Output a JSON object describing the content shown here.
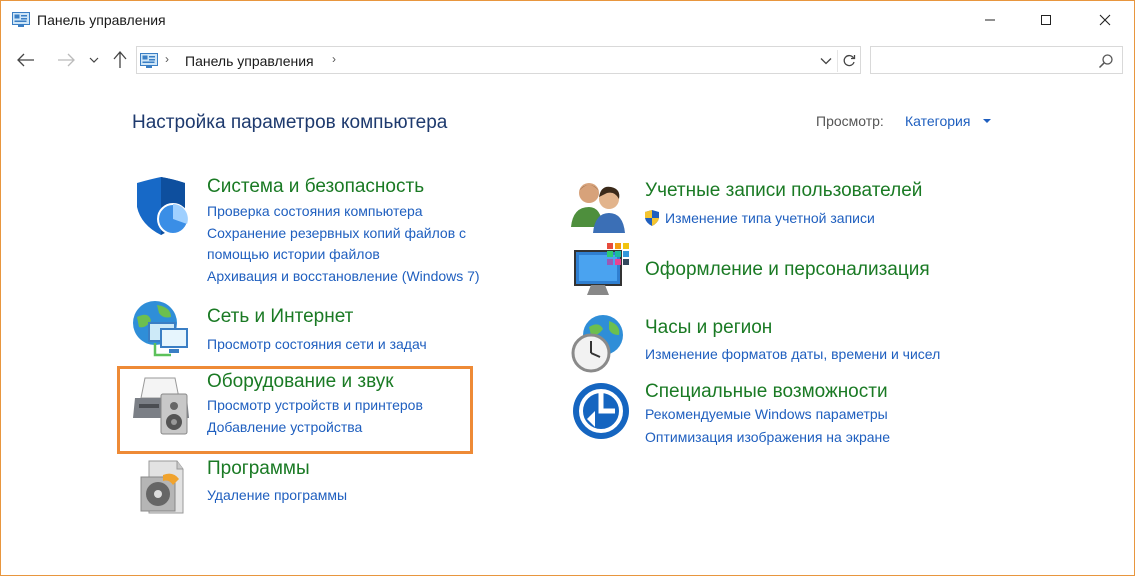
{
  "window": {
    "title": "Панель управления",
    "icons": {
      "app": "control-panel-icon",
      "minimize": "minimize-icon",
      "maximize": "maximize-icon",
      "close": "close-icon"
    }
  },
  "nav": {
    "address_path": "Панель управления",
    "search_placeholder": "",
    "icons": {
      "back": "arrow-left-icon",
      "forward": "arrow-right-icon",
      "recent": "chevron-down-icon",
      "up": "arrow-up-icon",
      "refresh": "refresh-icon",
      "search": "search-icon"
    }
  },
  "content": {
    "title": "Настройка параметров компьютера",
    "view_label": "Просмотр:",
    "view_value": "Категория"
  },
  "categories": {
    "security": {
      "title": "Система и безопасность",
      "links": [
        "Проверка состояния компьютера",
        "Сохранение резервных копий файлов с",
        "помощью истории файлов",
        "Архивация и восстановление (Windows 7)"
      ]
    },
    "network": {
      "title": "Сеть и Интернет",
      "links": [
        "Просмотр состояния сети и задач"
      ]
    },
    "hardware": {
      "title": "Оборудование и звук",
      "links": [
        "Просмотр устройств и принтеров",
        "Добавление устройства"
      ]
    },
    "programs": {
      "title": "Программы",
      "links": [
        "Удаление программы"
      ]
    },
    "accounts": {
      "title": "Учетные записи пользователей",
      "links": [
        "Изменение типа учетной записи"
      ]
    },
    "appearance": {
      "title": "Оформление и персонализация",
      "links": []
    },
    "clock": {
      "title": "Часы и регион",
      "links": [
        "Изменение форматов даты, времени и чисел"
      ]
    },
    "access": {
      "title": "Специальные возможности",
      "links": [
        "Рекомендуемые Windows параметры",
        "Оптимизация изображения на экране"
      ]
    }
  },
  "colors": {
    "accent_border": "#ee8a36",
    "category_title": "#1a7a24",
    "link": "#1f5fbf",
    "page_title": "#1e3a6e"
  }
}
